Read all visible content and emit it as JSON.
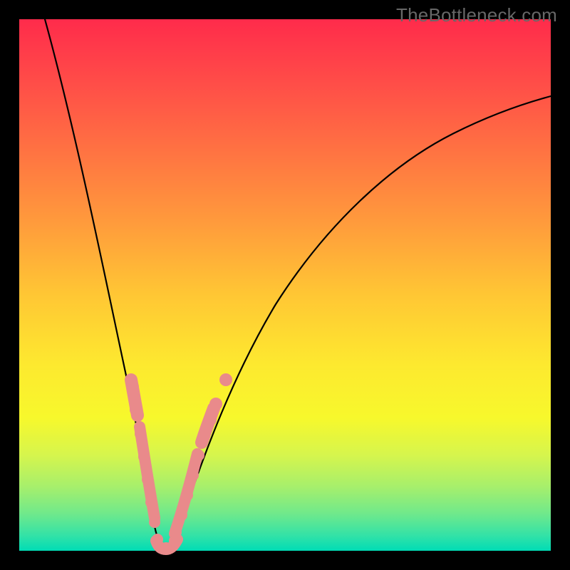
{
  "watermark": "TheBottleneck.com",
  "chart_data": {
    "type": "line",
    "title": "",
    "xlabel": "",
    "ylabel": "",
    "xlim": [
      0,
      100
    ],
    "ylim": [
      0,
      100
    ],
    "x": [
      0,
      5,
      10,
      15,
      20,
      23,
      25,
      30,
      35,
      40,
      45,
      50,
      55,
      60,
      65,
      70,
      75,
      80,
      85,
      90,
      95,
      100
    ],
    "values": [
      100,
      80,
      60,
      39,
      18,
      0,
      0,
      22,
      40,
      53,
      62,
      69,
      74,
      78,
      81,
      84,
      86,
      88,
      89,
      90,
      91,
      92
    ],
    "annotations": {
      "highlighted_ranges_left_y": [
        18,
        0
      ],
      "highlighted_ranges_right_y": [
        0,
        40
      ],
      "markers_left_y": [
        32,
        27,
        18,
        14,
        10,
        7,
        5,
        3,
        1
      ],
      "markers_right_y": [
        1,
        3,
        5,
        8,
        12,
        16,
        21,
        26,
        32,
        40
      ]
    }
  }
}
